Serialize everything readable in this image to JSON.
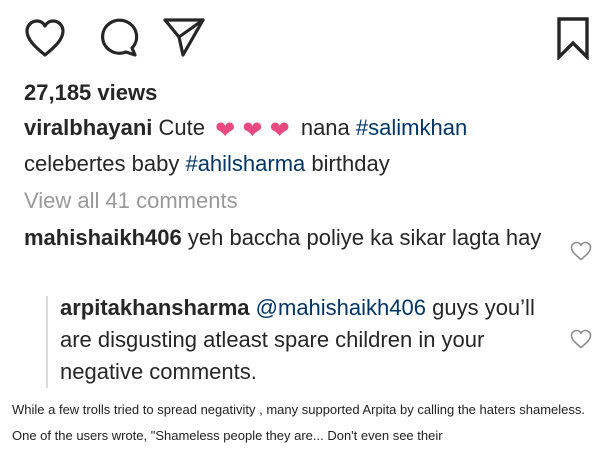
{
  "actions": {
    "like_icon": "heart-outline-icon",
    "comment_icon": "speech-bubble-icon",
    "share_icon": "paper-plane-icon",
    "save_icon": "bookmark-icon"
  },
  "post": {
    "views": "27,185 views",
    "caption": {
      "username": "viralbhayani",
      "text_before": "Cute",
      "emoji": [
        "❤",
        "❤",
        "❤"
      ],
      "text_middle": "nana",
      "hashtag1": "#salimkhan",
      "text_line2": "celebertes baby",
      "hashtag2": "#ahilsharma",
      "text_end": "birthday"
    },
    "view_all_comments": "View all 41 comments"
  },
  "comments": [
    {
      "username": "mahishaikh406",
      "text": "yeh baccha poliye ka sikar lagta hay"
    }
  ],
  "reply": {
    "username": "arpitakhansharma",
    "mention": "@mahishaikh406",
    "text": "guys you’ll are disgusting atleast spare children in your negative comments."
  },
  "article": {
    "text": "While a few trolls tried to spread negativity , many supported Arpita by calling the haters shameless. One of the users wrote, \"Shameless people they are... Don't even see their"
  },
  "colors": {
    "heart_emoji": "#e84a7f",
    "hashtag": "#003569",
    "muted": "#999999"
  }
}
